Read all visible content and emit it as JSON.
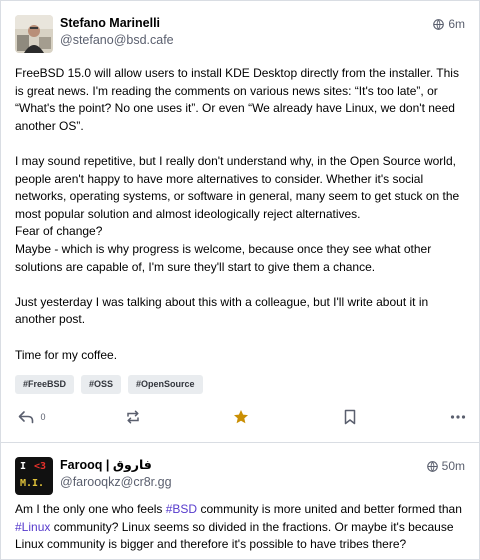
{
  "post1": {
    "display_name": "Stefano Marinelli",
    "handle": "@stefano@bsd.cafe",
    "time": "6m",
    "paragraphs": [
      "FreeBSD 15.0 will allow users to install KDE Desktop directly from the installer. This is great news. I'm reading the comments on various news sites: “It's too late”, or “What's the point? No one uses it”. Or even “We already have Linux, we don't need another OS”.",
      "I may sound repetitive, but I really don't understand why, in the Open Source world, people aren't happy to have more alternatives to consider. Whether it's social networks, operating systems, or software in general, many seem to get stuck on the most popular solution and almost ideologically reject alternatives.",
      "Fear of change?",
      "Maybe - which is why progress is welcome, because once they see what other solutions are capable of, I'm sure they'll start to give them a chance.",
      "Just yesterday I was talking about this with a colleague, but I'll write about it in another post.",
      "Time for my coffee."
    ],
    "tags": [
      "#FreeBSD",
      "#OSS",
      "#OpenSource"
    ],
    "reply_count": "0",
    "accent_color": "#ca8f04",
    "icons": {
      "visibility": "globe-icon",
      "reply": "reply-icon",
      "boost": "boost-icon",
      "favourite": "star-icon",
      "bookmark": "bookmark-icon",
      "more": "more-icon"
    }
  },
  "post2": {
    "display_name": "Farooq | فاروق",
    "handle": "@farooqkz@cr8r.gg",
    "time": "50m",
    "avatar_text": [
      "I",
      "<3",
      "M.I."
    ],
    "content": {
      "t1": "Am I the only one who feels ",
      "tag1": "#BSD",
      "t2": " community is more united and better formed than ",
      "tag2": "#Linux",
      "t3": " community? Linux seems so divided in the fractions. Or maybe it's because Linux community is bigger and therefore it's possible to have tribes there?"
    },
    "link_color": "#563acc"
  }
}
